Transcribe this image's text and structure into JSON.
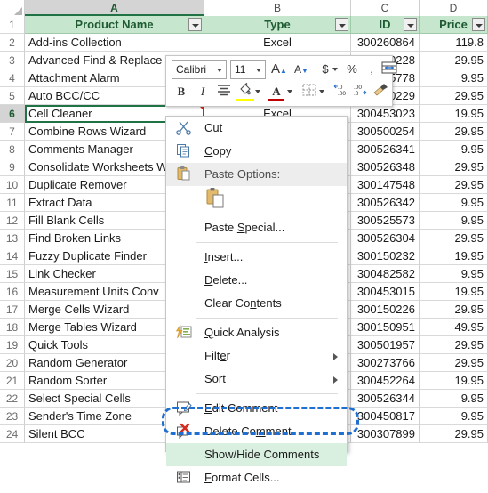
{
  "app": "excel-spreadsheet",
  "grid": {
    "column_letters": [
      "A",
      "B",
      "C",
      "D"
    ],
    "selected_column": "A",
    "selected_cell": "A6",
    "columns": [
      {
        "letter": "A",
        "header": "Product Name",
        "align": "center"
      },
      {
        "letter": "B",
        "header": "Type",
        "align": "center"
      },
      {
        "letter": "C",
        "header": "ID",
        "align": "center"
      },
      {
        "letter": "D",
        "header": "Price",
        "align": "center"
      }
    ],
    "rows": [
      {
        "n": "1",
        "product": "Product Name",
        "type": "Type",
        "id": "ID",
        "price": "Price"
      },
      {
        "n": "2",
        "product": "Add-ins Collection",
        "type": "Excel",
        "id": "300260864",
        "price": "119.8"
      },
      {
        "n": "3",
        "product": "Advanced Find & Replace",
        "type": "",
        "id": "300260228",
        "price": "29.95"
      },
      {
        "n": "4",
        "product": "Attachment Alarm",
        "type": "",
        "id": "300265778",
        "price": "9.95"
      },
      {
        "n": "5",
        "product": "Auto BCC/CC",
        "type": "",
        "id": "300260229",
        "price": "29.95"
      },
      {
        "n": "6",
        "product": "Cell Cleaner",
        "type": "Excel",
        "id": "300453023",
        "price": "19.95"
      },
      {
        "n": "7",
        "product": "Combine Rows Wizard",
        "type": "",
        "id": "300500254",
        "price": "29.95"
      },
      {
        "n": "8",
        "product": "Comments Manager",
        "type": "",
        "id": "300526341",
        "price": "9.95"
      },
      {
        "n": "9",
        "product": "Consolidate Worksheets W",
        "type": "",
        "id": "300526348",
        "price": "29.95"
      },
      {
        "n": "10",
        "product": "Duplicate Remover",
        "type": "",
        "id": "300147548",
        "price": "29.95"
      },
      {
        "n": "11",
        "product": "Extract Data",
        "type": "",
        "id": "300526342",
        "price": "9.95"
      },
      {
        "n": "12",
        "product": "Fill Blank Cells",
        "type": "",
        "id": "300525573",
        "price": "9.95"
      },
      {
        "n": "13",
        "product": "Find Broken Links",
        "type": "",
        "id": "300526304",
        "price": "29.95"
      },
      {
        "n": "14",
        "product": "Fuzzy Duplicate Finder",
        "type": "",
        "id": "300150232",
        "price": "19.95"
      },
      {
        "n": "15",
        "product": "Link Checker",
        "type": "",
        "id": "300482582",
        "price": "9.95"
      },
      {
        "n": "16",
        "product": "Measurement Units Conv",
        "type": "",
        "id": "300453015",
        "price": "19.95"
      },
      {
        "n": "17",
        "product": "Merge Cells Wizard",
        "type": "",
        "id": "300150226",
        "price": "29.95"
      },
      {
        "n": "18",
        "product": "Merge Tables Wizard",
        "type": "",
        "id": "300150951",
        "price": "49.95"
      },
      {
        "n": "19",
        "product": "Quick Tools",
        "type": "",
        "id": "300501957",
        "price": "29.95"
      },
      {
        "n": "20",
        "product": "Random Generator",
        "type": "",
        "id": "300273766",
        "price": "29.95"
      },
      {
        "n": "21",
        "product": "Random Sorter",
        "type": "",
        "id": "300452264",
        "price": "19.95"
      },
      {
        "n": "22",
        "product": "Select Special Cells",
        "type": "",
        "id": "300526344",
        "price": "9.95"
      },
      {
        "n": "23",
        "product": "Sender's Time Zone",
        "type": "",
        "id": "300450817",
        "price": "9.95"
      },
      {
        "n": "24",
        "product": "Silent BCC",
        "type": "",
        "id": "300307899",
        "price": "29.95"
      }
    ]
  },
  "mini_toolbar": {
    "font_name": "Calibri",
    "font_size": "11",
    "buttons": [
      {
        "name": "grow-font-icon",
        "label": "A"
      },
      {
        "name": "shrink-font-icon",
        "label": "A"
      },
      {
        "name": "accounting-format-icon",
        "label": "$"
      },
      {
        "name": "percent-style-icon",
        "label": "%"
      },
      {
        "name": "comma-style-icon",
        "label": ","
      },
      {
        "name": "merge-center-icon",
        "label": ""
      },
      {
        "name": "bold-icon",
        "label": "B"
      },
      {
        "name": "italic-icon",
        "label": "I"
      },
      {
        "name": "center-align-icon",
        "label": ""
      },
      {
        "name": "fill-color-icon",
        "label": ""
      },
      {
        "name": "font-color-icon",
        "label": "A"
      },
      {
        "name": "borders-icon",
        "label": ""
      },
      {
        "name": "increase-decimal-icon",
        "label": ""
      },
      {
        "name": "decrease-decimal-icon",
        "label": ""
      },
      {
        "name": "format-painter-icon",
        "label": ""
      }
    ]
  },
  "context_menu": {
    "items": [
      {
        "label": "Cut",
        "accel": "t",
        "icon": "scissors-icon",
        "kind": "item"
      },
      {
        "label": "Copy",
        "accel": "C",
        "icon": "copy-icon",
        "kind": "item"
      },
      {
        "label": "Paste Options:",
        "accel": "",
        "icon": "paste-icon",
        "kind": "header"
      },
      {
        "label": "",
        "accel": "",
        "icon": "paste-keep-formatting-icon",
        "kind": "paste-gallery"
      },
      {
        "label": "Paste Special...",
        "accel": "S",
        "icon": "",
        "kind": "item"
      },
      {
        "label": "",
        "kind": "separator"
      },
      {
        "label": "Insert...",
        "accel": "I",
        "icon": "",
        "kind": "item"
      },
      {
        "label": "Delete...",
        "accel": "D",
        "icon": "",
        "kind": "item"
      },
      {
        "label": "Clear Contents",
        "accel": "n",
        "icon": "",
        "kind": "item"
      },
      {
        "label": "",
        "kind": "separator"
      },
      {
        "label": "Quick Analysis",
        "accel": "Q",
        "icon": "quick-analysis-icon",
        "kind": "item"
      },
      {
        "label": "Filter",
        "accel": "e",
        "icon": "",
        "kind": "submenu"
      },
      {
        "label": "Sort",
        "accel": "o",
        "icon": "",
        "kind": "submenu"
      },
      {
        "label": "",
        "kind": "separator"
      },
      {
        "label": "Edit Comment",
        "accel": "E",
        "icon": "edit-comment-icon",
        "kind": "item"
      },
      {
        "label": "Delete Comment",
        "accel": "m",
        "icon": "delete-comment-icon",
        "kind": "item"
      },
      {
        "label": "Show/Hide Comments",
        "accel": "o",
        "icon": "",
        "kind": "item",
        "highlighted": true
      },
      {
        "label": "Format Cells...",
        "accel": "F",
        "icon": "format-cells-icon",
        "kind": "item"
      }
    ],
    "highlight_label": "Show/Hide Comments"
  },
  "colors": {
    "excel_green": "#217346",
    "header_fill": "#c6e7ce",
    "highlight_fill": "#d9efdf",
    "annotation_blue": "#1f6fd0",
    "comment_flag_red": "#d62b1f"
  }
}
